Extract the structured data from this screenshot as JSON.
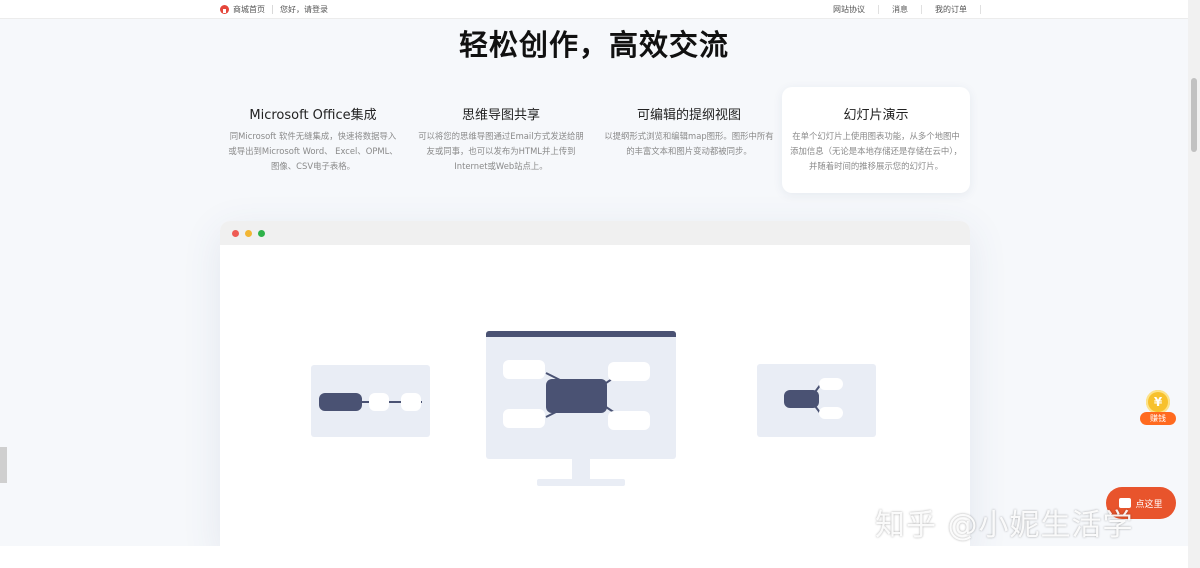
{
  "topbar": {
    "home_label": "商城首页",
    "login_label": "您好，请登录",
    "links": [
      "网站协议",
      "消息",
      "我的订单"
    ]
  },
  "main_title": "轻松创作，高效交流",
  "features": [
    {
      "title": "Microsoft Office集成",
      "desc": "同Microsoft 软件无缝集成，快速将数据导入或导出到Microsoft Word、 Excel、OPML、图像、CSV电子表格。"
    },
    {
      "title": "思维导图共享",
      "desc": "可以将您的思维导图通过Email方式发送给朋友或同事，也可以发布为HTML并上传到Internet或Web站点上。"
    },
    {
      "title": "可编辑的提纲视图",
      "desc": "以提纲形式浏览和编辑map图形。图形中所有的丰富文本和图片变动都被同步。"
    },
    {
      "title": "幻灯片演示",
      "desc": "在单个幻灯片上使用图表功能，从多个地图中添加信息（无论是本地存储还是存储在云中），并随着时间的推移展示您的幻灯片。"
    }
  ],
  "widgets": {
    "coin_symbol": "¥",
    "coin_label": "赚钱",
    "chat_label": "点这里"
  },
  "watermark": "知乎 @小妮生活学"
}
